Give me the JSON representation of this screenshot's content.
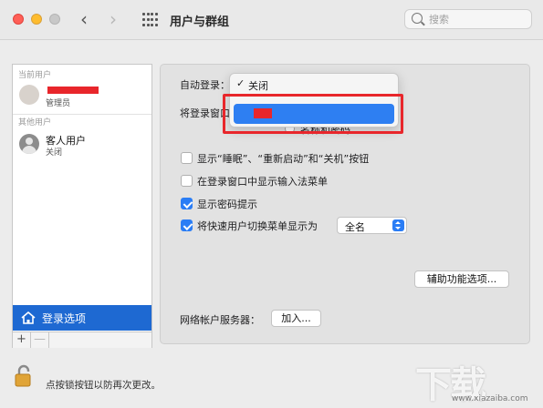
{
  "window": {
    "title": "用户与群组"
  },
  "search": {
    "placeholder": "搜索"
  },
  "sidebar": {
    "current_user_label": "当前用户",
    "current_user": {
      "role": "管理员"
    },
    "other_users_label": "其他用户",
    "guest_user": {
      "name": "客人用户",
      "status": "关闭"
    },
    "login_options_label": "登录选项",
    "add_symbol": "+",
    "remove_symbol": "—"
  },
  "main": {
    "auto_login_label": "自动登录：",
    "display_login_window_label": "将登录窗口",
    "name_password_option": "名称和密码",
    "show_buttons_label": "显示“睡眠”、“重新启动”和“关机”按钮",
    "show_input_menu_label": "在登录窗口中显示输入法菜单",
    "show_password_hints_label": "显示密码提示",
    "fast_user_switch_label": "将快速用户切换菜单显示为",
    "fast_user_switch_value": "全名",
    "accessibility_button": "辅助功能选项...",
    "network_server_label": "网络帐户服务器：",
    "join_button": "加入..."
  },
  "checkboxes": {
    "show_buttons": false,
    "show_input_menu": false,
    "show_password_hints": true,
    "fast_user_switch": true
  },
  "dropdown": {
    "checkmark": "✓",
    "selected_item": "关闭"
  },
  "footer": {
    "lock_text": "点按锁按钮以防再次更改。"
  },
  "watermark": {
    "big": "下载",
    "small": "www.xiazaiba.com"
  },
  "icons": {
    "back": "chevron-left-icon",
    "forward": "chevron-right-icon",
    "grid": "grid-icon",
    "search": "search-icon",
    "home": "house-icon",
    "lock": "lock-icon"
  },
  "colors": {
    "accent": "#2a7df5",
    "sidebar_selected": "#1e69d2",
    "highlight": "#e8262b"
  }
}
